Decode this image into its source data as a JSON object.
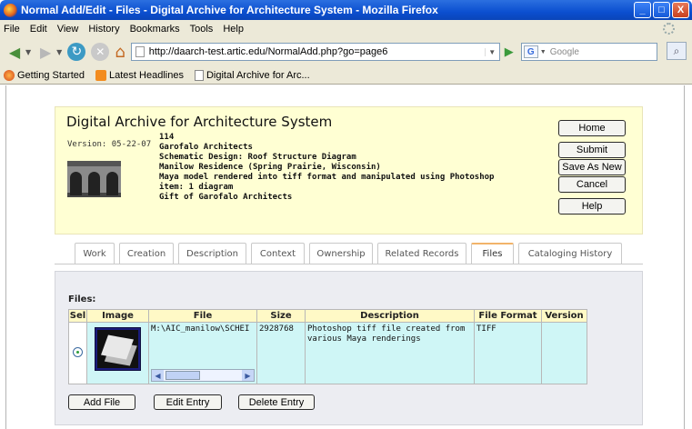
{
  "window": {
    "title": "Normal Add/Edit - Files - Digital Archive for Architecture System - Mozilla Firefox",
    "minimize": "_",
    "maximize": "□",
    "close": "X"
  },
  "menu": [
    "File",
    "Edit",
    "View",
    "History",
    "Bookmarks",
    "Tools",
    "Help"
  ],
  "nav": {
    "url": "http://daarch-test.artic.edu/NormalAdd.php?go=page6",
    "search_placeholder": "Google"
  },
  "bookmarks": [
    "Getting Started",
    "Latest Headlines",
    "Digital Archive for Arc..."
  ],
  "header": {
    "title": "Digital Archive for Architecture System",
    "version": "Version: 05-22-07",
    "record_lines": [
      "114",
      "Garofalo Architects",
      "Schematic Design: Roof Structure Diagram",
      "Manilow Residence (Spring Prairie, Wisconsin)",
      "Maya model rendered into tiff format and manipulated using Photoshop",
      "item: 1 diagram",
      "Gift of Garofalo Architects"
    ],
    "buttons": [
      "Home",
      "Submit",
      "Save As New",
      "Cancel",
      "Help"
    ]
  },
  "tabs": [
    {
      "label": "Work",
      "active": false
    },
    {
      "label": "Creation",
      "active": false
    },
    {
      "label": "Description",
      "active": false
    },
    {
      "label": "Context",
      "active": false
    },
    {
      "label": "Ownership",
      "active": false
    },
    {
      "label": "Related Records",
      "active": false
    },
    {
      "label": "Files",
      "active": true
    },
    {
      "label": "Cataloging History",
      "active": false
    }
  ],
  "files": {
    "label": "Files:",
    "columns": [
      "Sel",
      "Image",
      "File",
      "Size",
      "Description",
      "File Format",
      "Version"
    ],
    "rows": [
      {
        "selected": true,
        "file": "M:\\AIC_manilow\\SCHEI",
        "size": "2928768",
        "description_lines": [
          "Photoshop tiff file created from",
          "various Maya renderings"
        ],
        "format": "TIFF",
        "version": ""
      }
    ],
    "buttons": [
      "Add File",
      "Edit Entry",
      "Delete Entry"
    ]
  }
}
